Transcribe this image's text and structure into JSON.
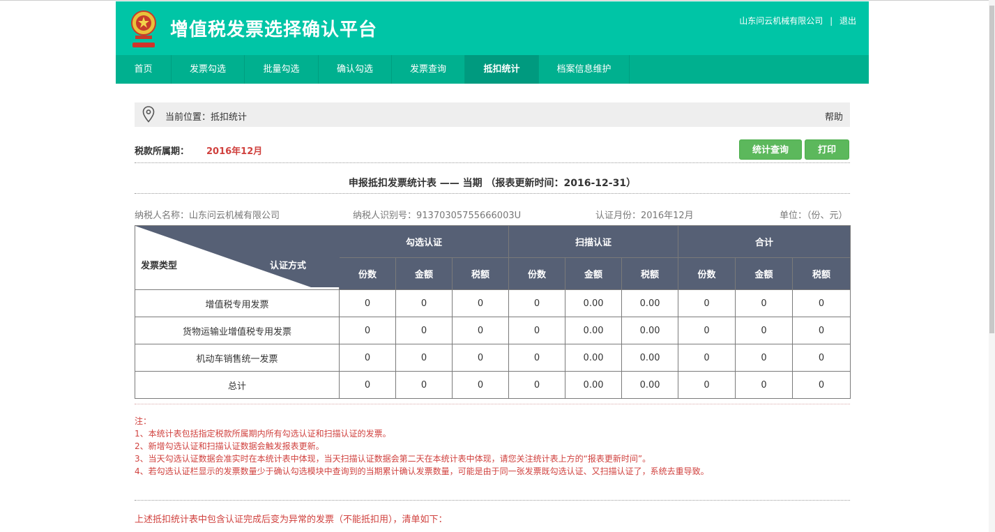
{
  "app": {
    "title": "增值税发票选择确认平台",
    "company": "山东问云机械有限公司",
    "separator": "|",
    "logout_label": "退出"
  },
  "nav": {
    "items": [
      {
        "label": "首页"
      },
      {
        "label": "发票勾选"
      },
      {
        "label": "批量勾选"
      },
      {
        "label": "确认勾选"
      },
      {
        "label": "发票查询"
      },
      {
        "label": "抵扣统计"
      },
      {
        "label": "档案信息维护"
      }
    ],
    "active_index": 5
  },
  "breadcrumb": {
    "text": "当前位置：抵扣统计",
    "help_label": "帮助",
    "icon": "location-pin-icon"
  },
  "period": {
    "label": "税款所属期：",
    "value": "2016年12月"
  },
  "buttons": {
    "query_label": "统计查询",
    "print_label": "打印"
  },
  "report": {
    "title": "申报抵扣发票统计表 —— 当期 （报表更新时间：2016-12-31）",
    "taxpayer_name": "纳税人名称：山东问云机械有限公司",
    "taxpayer_id": "纳税人识别号：91370305755666003U",
    "cert_month": "认证月份：2016年12月",
    "unit": "单位：（份、元）"
  },
  "table": {
    "corner_left": "发票类型",
    "corner_right": "认证方式",
    "groups": [
      "勾选认证",
      "扫描认证",
      "合计"
    ],
    "subcols": [
      "份数",
      "金额",
      "税额",
      "份数",
      "金额",
      "税额",
      "份数",
      "金额",
      "税额"
    ],
    "rows": [
      {
        "type": "增值税专用发票",
        "cells": [
          "0",
          "0",
          "0",
          "0",
          "0.00",
          "0.00",
          "0",
          "0",
          "0"
        ]
      },
      {
        "type": "货物运输业增值税专用发票",
        "cells": [
          "0",
          "0",
          "0",
          "0",
          "0.00",
          "0.00",
          "0",
          "0",
          "0"
        ]
      },
      {
        "type": "机动车销售统一发票",
        "cells": [
          "0",
          "0",
          "0",
          "0",
          "0.00",
          "0.00",
          "0",
          "0",
          "0"
        ]
      },
      {
        "type": "总计",
        "cells": [
          "0",
          "0",
          "0",
          "0",
          "0.00",
          "0.00",
          "0",
          "0",
          "0"
        ]
      }
    ]
  },
  "notes": {
    "title": "注：",
    "items": [
      "1、本统计表包括指定税款所属期内所有勾选认证和扫描认证的发票。",
      "2、新增勾选认证和扫描认证数据会触发报表更新。",
      "3、当天勾选认证数据会准实时在本统计表中体现，当天扫描认证数据会第二天在本统计表中体现，请您关注统计表上方的“报表更新时间”。",
      "4、若勾选认证栏显示的发票数量少于确认勾选模块中查询到的当期累计确认发票数量，可能是由于同一张发票既勾选认证、又扫描认证了，系统去重导致。"
    ]
  },
  "abnormal_list_title": "上述抵扣统计表中包含认证完成后变为异常的发票（不能抵扣用），清单如下：",
  "colors": {
    "header_bg": "#00c5a6",
    "nav_bg": "#00b08f",
    "nav_active": "#009a7f",
    "table_header": "#566075",
    "accent_red": "#d0413e",
    "button_green": "#5cb85c"
  }
}
